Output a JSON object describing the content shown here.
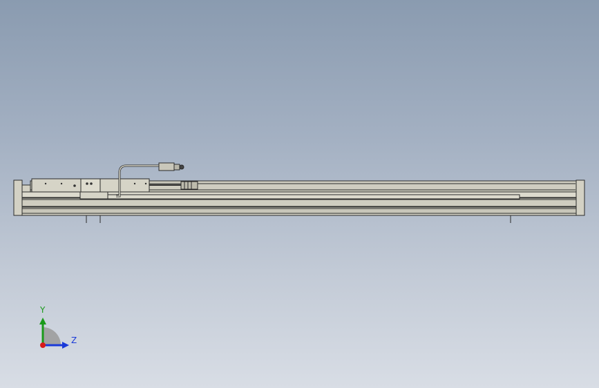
{
  "viewport": {
    "background_top": "#8a9bb0",
    "background_bottom": "#d8dde5"
  },
  "model": {
    "part_fill": "#d3d1c4",
    "part_stroke": "#2a2a2a",
    "description_icon": "linear-actuator-side-view"
  },
  "triad": {
    "y_label": "Y",
    "z_label": "Z",
    "y_color": "#1a9a1a",
    "z_color": "#1a3ad8",
    "x_color": "#d81a1a"
  }
}
